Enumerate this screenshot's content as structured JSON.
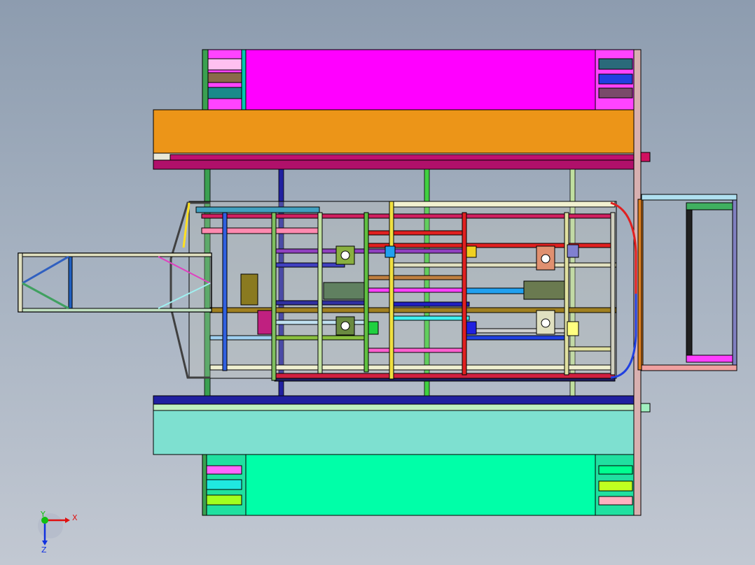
{
  "viewport": {
    "background_top": "#8d9caf",
    "background_bottom": "#c2c8d2"
  },
  "model": {
    "colors": {
      "outline": "#000000",
      "magenta": "#ff00ff",
      "orange": "#ec9518",
      "crimson": "#c01070",
      "navy": "#2020a0",
      "teal_panel": "#7ee0d0",
      "mint": "#00ffa8",
      "green_post": "#3aa050",
      "red_tube": "#e02020",
      "blue_tube": "#2040e0"
    }
  },
  "triad": {
    "x_label": "X",
    "y_label": "Y",
    "z_label": "Z",
    "x_color": "#e01010",
    "y_color": "#10c010",
    "z_color": "#1030e0"
  }
}
